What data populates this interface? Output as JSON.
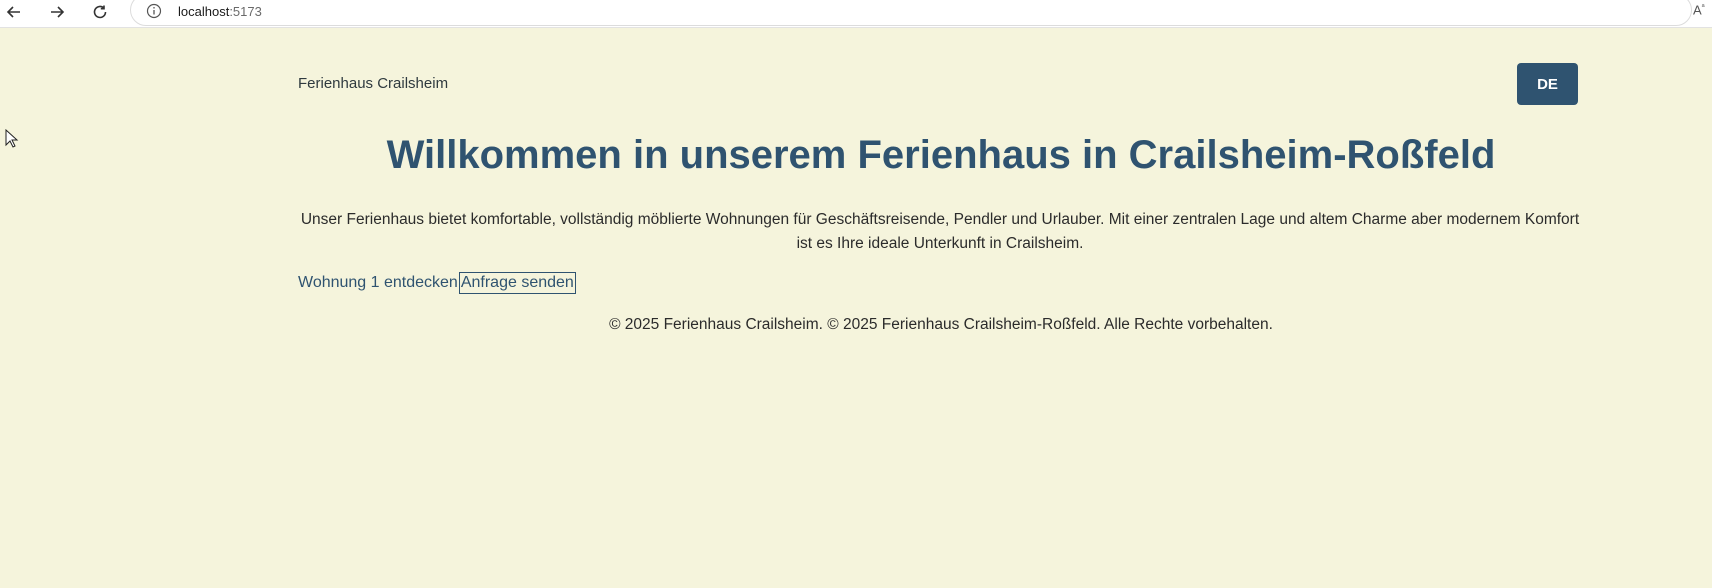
{
  "browser": {
    "url_host": "localhost",
    "url_port": ":5173",
    "icons": [
      "back-arrow-icon",
      "forward-arrow-icon",
      "reload-icon",
      "info-icon",
      "read-aloud-icon"
    ],
    "reader_label": "A"
  },
  "header": {
    "brand": "Ferienhaus Crailsheim",
    "language_button": "DE"
  },
  "hero": {
    "title": "Willkommen in unserem Ferienhaus in Crailsheim-Roßfeld",
    "description": "Unser Ferienhaus bietet komfortable, vollständig möblierte Wohnungen für Geschäftsreisende, Pendler und Urlauber. Mit einer zentralen Lage und altem Charme aber modernem Komfort ist es Ihre ideale Unterkunft in Crailsheim."
  },
  "links": {
    "explore": "Wohnung 1 entdecken",
    "request": "Anfrage senden"
  },
  "footer": {
    "text": "© 2025 Ferienhaus Crailsheim. © 2025 Ferienhaus Crailsheim-Roßfeld. Alle Rechte vorbehalten."
  },
  "colors": {
    "background": "#f5f4dc",
    "accent": "#2f5370"
  }
}
